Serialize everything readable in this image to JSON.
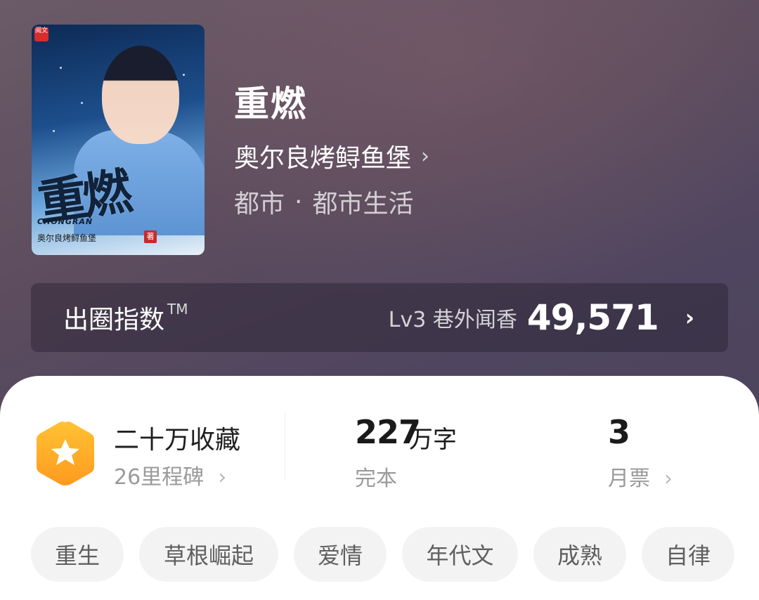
{
  "cover": {
    "title_art": "重燃",
    "pinyin": "CHONGRAN",
    "author_line": "奥尔良烤鲟鱼堡",
    "author_mark": "著",
    "publisher_badge": "阅文"
  },
  "book": {
    "title": "重燃",
    "author": "奥尔良烤鲟鱼堡",
    "genre_main": "都市",
    "genre_separator": "·",
    "genre_sub": "都市生活"
  },
  "index_bar": {
    "label": "出圈指数",
    "trademark": "TM",
    "level": "Lv3 巷外闻香",
    "score": "49,571"
  },
  "stats": {
    "favorites_title": "二十万收藏",
    "milestones": "26里程碑",
    "word_count": "227",
    "word_unit": "万字",
    "status": "完本",
    "monthly_tickets": "3",
    "monthly_tickets_label": "月票"
  },
  "tags": [
    "重生",
    "草根崛起",
    "爱情",
    "年代文",
    "成熟",
    "自律"
  ],
  "colors": {
    "hex_badge_top": "#ffc233",
    "hex_badge_bottom": "#ff9a1f",
    "tag_bg": "#f3f3f3"
  },
  "icons": {
    "chevron": "chevron-right-icon",
    "badge": "star-hexagon-icon"
  }
}
